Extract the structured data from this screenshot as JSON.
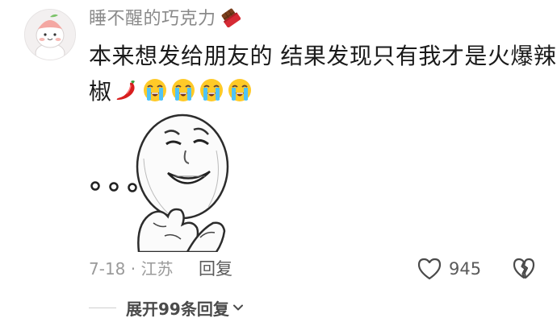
{
  "comment": {
    "username": "睡不醒的巧克力",
    "username_emoji": "chocolate-icon",
    "text_line1": "本来想发给朋友的 结果发现只有我才是火爆辣",
    "text_line2": "椒",
    "inline_emojis": [
      "hot-pepper-icon",
      "loudly-crying-face-icon",
      "loudly-crying-face-icon",
      "loudly-crying-face-icon",
      "loudly-crying-face-icon"
    ],
    "sticker": "smiling-face-meme-sticker",
    "date_location": "7-18 · 江苏",
    "reply_label": "回复",
    "like_count": "945",
    "expand_label": "展开99条回复"
  },
  "colors": {
    "username": "#8a8a8a",
    "text": "#1a1a1a",
    "meta": "#9a9a9a",
    "action": "#5a5a5a"
  }
}
